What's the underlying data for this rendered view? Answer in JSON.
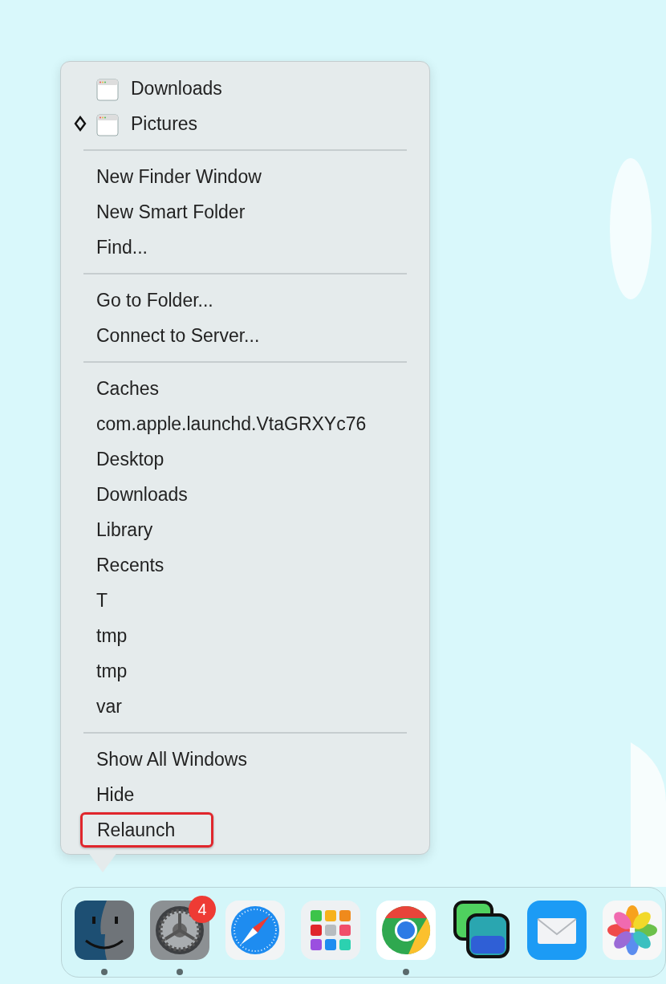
{
  "menu": {
    "sections": [
      {
        "items": [
          {
            "kind": "window",
            "label": "Downloads",
            "current": false,
            "outlined": false
          },
          {
            "kind": "window",
            "label": "Pictures",
            "current": true,
            "outlined": false
          }
        ]
      },
      {
        "items": [
          {
            "kind": "command",
            "label": "New Finder Window",
            "outlined": false
          },
          {
            "kind": "command",
            "label": "New Smart Folder",
            "outlined": false
          },
          {
            "kind": "command",
            "label": "Find...",
            "outlined": false
          }
        ]
      },
      {
        "items": [
          {
            "kind": "command",
            "label": "Go to Folder...",
            "outlined": false
          },
          {
            "kind": "command",
            "label": "Connect to Server...",
            "outlined": false
          }
        ]
      },
      {
        "items": [
          {
            "kind": "command",
            "label": "Caches",
            "outlined": false
          },
          {
            "kind": "command",
            "label": "com.apple.launchd.VtaGRXYc76",
            "outlined": false
          },
          {
            "kind": "command",
            "label": "Desktop",
            "outlined": false
          },
          {
            "kind": "command",
            "label": "Downloads",
            "outlined": false
          },
          {
            "kind": "command",
            "label": "Library",
            "outlined": false
          },
          {
            "kind": "command",
            "label": "Recents",
            "outlined": false
          },
          {
            "kind": "command",
            "label": "T",
            "outlined": false
          },
          {
            "kind": "command",
            "label": "tmp",
            "outlined": false
          },
          {
            "kind": "command",
            "label": "tmp",
            "outlined": false
          },
          {
            "kind": "command",
            "label": "var",
            "outlined": false
          }
        ]
      },
      {
        "items": [
          {
            "kind": "command",
            "label": "Show All Windows",
            "outlined": false
          },
          {
            "kind": "command",
            "label": "Hide",
            "outlined": false
          },
          {
            "kind": "command",
            "label": "Relaunch",
            "outlined": true
          }
        ]
      }
    ]
  },
  "dock": {
    "apps": [
      {
        "kind": "finder",
        "running": true
      },
      {
        "kind": "settings",
        "running": true,
        "badge": "4"
      },
      {
        "kind": "compass",
        "running": false
      },
      {
        "kind": "launcher",
        "running": false
      },
      {
        "kind": "chrome",
        "running": true
      },
      {
        "kind": "windows",
        "running": false
      },
      {
        "kind": "mail",
        "running": false
      },
      {
        "kind": "photos",
        "running": false
      }
    ]
  }
}
